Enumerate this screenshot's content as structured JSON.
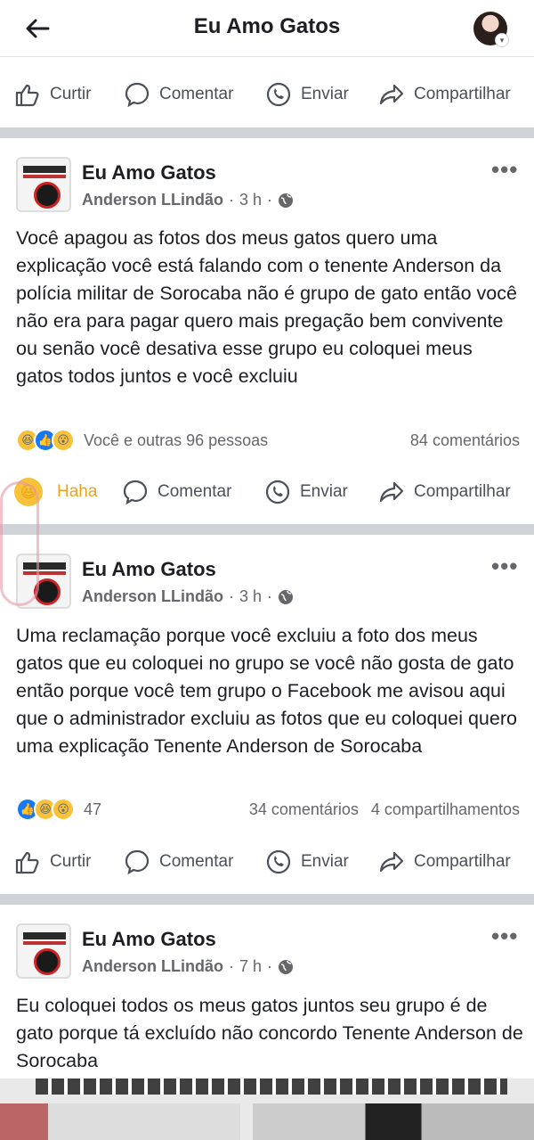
{
  "header": {
    "title": "Eu Amo Gatos"
  },
  "actions": {
    "like": "Curtir",
    "comment": "Comentar",
    "send": "Enviar",
    "share": "Compartilhar",
    "haha": "Haha"
  },
  "posts": [
    {
      "group": "Eu Amo Gatos",
      "author": "Anderson LLindão",
      "time": "3 h",
      "text": "Você apagou as fotos dos meus gatos quero uma explicação você está falando com o tenente Anderson da polícia militar de Sorocaba não é grupo de gato então você não era para pagar quero mais pregação bem convivente ou senão você desativa esse grupo eu coloquei meus gatos todos juntos e você excluiu",
      "reactions_text": "Você e outras 96 pessoas",
      "comments": "84 comentários",
      "shares": ""
    },
    {
      "group": "Eu Amo Gatos",
      "author": "Anderson LLindão",
      "time": "3 h",
      "text": "Uma reclamação porque você excluiu a foto dos meus gatos que eu coloquei no grupo se você não gosta de gato então porque você tem grupo o Facebook me avisou aqui que o administrador excluiu as fotos que eu coloquei quero uma explicação Tenente Anderson de Sorocaba",
      "reactions_text": "47",
      "comments": "34 comentários",
      "shares": "4 compartilhamentos"
    },
    {
      "group": "Eu Amo Gatos",
      "author": "Anderson LLindão",
      "time": "7 h",
      "text": "Eu coloquei todos os meus gatos juntos seu grupo é de gato porque tá excluído não concordo Tenente Anderson de Sorocaba"
    }
  ]
}
